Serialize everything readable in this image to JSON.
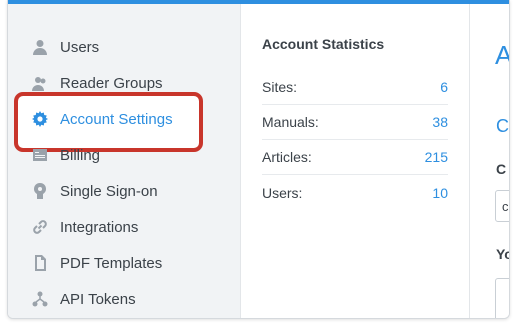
{
  "colors": {
    "accent": "#2e8fe0",
    "highlight": "#c8352b"
  },
  "sidebar": {
    "items": [
      {
        "label": "Users",
        "icon": "user-icon"
      },
      {
        "label": "Reader Groups",
        "icon": "users-icon"
      },
      {
        "label": "Account Settings",
        "icon": "gear-icon",
        "active": true
      },
      {
        "label": "Billing",
        "icon": "billing-icon"
      },
      {
        "label": "Single Sign-on",
        "icon": "key-icon"
      },
      {
        "label": "Integrations",
        "icon": "link-icon"
      },
      {
        "label": "PDF Templates",
        "icon": "file-icon"
      },
      {
        "label": "API Tokens",
        "icon": "network-icon"
      }
    ]
  },
  "stats": {
    "title": "Account Statistics",
    "rows": [
      {
        "label": "Sites:",
        "value": "6"
      },
      {
        "label": "Manuals:",
        "value": "38"
      },
      {
        "label": "Articles:",
        "value": "215"
      },
      {
        "label": "Users:",
        "value": "10"
      }
    ]
  },
  "right": {
    "title": "A",
    "subtitle": "C",
    "label1": "C",
    "input_value": "c",
    "label2": "Yo"
  }
}
